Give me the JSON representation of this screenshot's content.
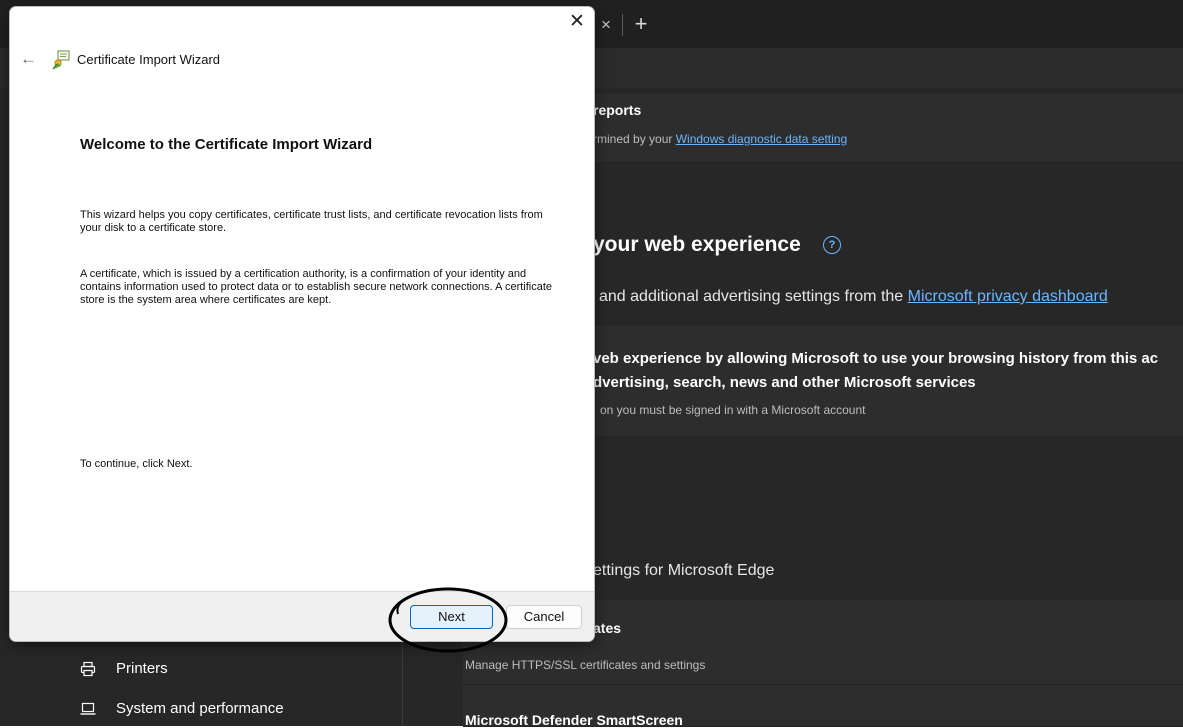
{
  "edge": {
    "tab_close_glyph": "×",
    "new_tab_glyph": "+",
    "diagnostic": {
      "title_fragment": "reports",
      "desc_prefix": "rmined by your ",
      "desc_link": "Windows diagnostic data setting"
    },
    "personalize": {
      "heading_fragment": "your web experience",
      "help_glyph": "?",
      "subtitle_prefix": "and additional advertising settings from the ",
      "subtitle_link": "Microsoft privacy dashboard"
    },
    "personalize_card": {
      "line1": "veb experience by allowing Microsoft to use your browsing history from this ac",
      "line2": "dvertising, search, news and other Microsoft services",
      "note": "on you must be signed in with a Microsoft account"
    },
    "security_heading_fragment": "ettings for Microsoft Edge",
    "certificates": {
      "title_fragment": "ates",
      "desc": "Manage HTTPS/SSL certificates and settings"
    },
    "smartscreen_title": "Microsoft Defender SmartScreen",
    "sidebar": {
      "items": [
        {
          "label": "Printers",
          "icon": "printer-icon"
        },
        {
          "label": "System and performance",
          "icon": "laptop-icon"
        }
      ]
    },
    "colors": {
      "link": "#6cb6ff",
      "background": "#272727",
      "card": "#2d2d2d"
    }
  },
  "dialog": {
    "title": "Certificate Import Wizard",
    "close_glyph": "✕",
    "back_glyph": "←",
    "heading": "Welcome to the Certificate Import Wizard",
    "para1": "This wizard helps you copy certificates, certificate trust lists, and certificate revocation lists from your disk to a certificate store.",
    "para2": "A certificate, which is issued by a certification authority, is a confirmation of your identity and contains information used to protect data or to establish secure network connections. A certificate store is the system area where certificates are kept.",
    "para3": "To continue, click Next.",
    "buttons": {
      "next": "Next",
      "cancel": "Cancel"
    },
    "colors": {
      "accent": "#0067c0"
    }
  }
}
